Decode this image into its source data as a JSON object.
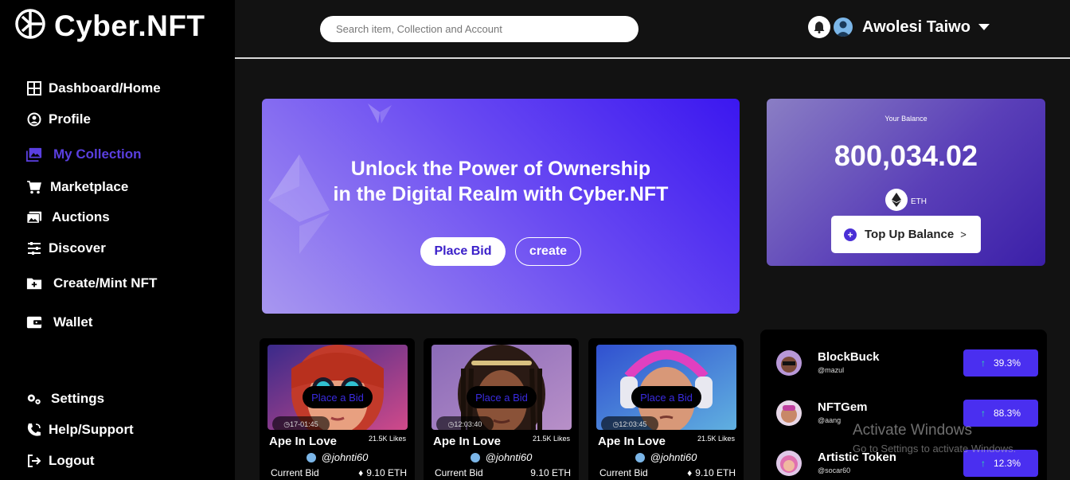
{
  "brand": {
    "name": "Cyber.NFT"
  },
  "sidebar": {
    "items": [
      {
        "label": "Dashboard/Home",
        "icon": "grid-icon"
      },
      {
        "label": "Profile",
        "icon": "user-circle-icon"
      },
      {
        "label": "My Collection",
        "icon": "images-icon"
      },
      {
        "label": "Marketplace",
        "icon": "cart-icon"
      },
      {
        "label": "Auctions",
        "icon": "photos-icon"
      },
      {
        "label": "Discover",
        "icon": "sliders-icon"
      },
      {
        "label": "Create/Mint NFT",
        "icon": "folder-plus-icon"
      },
      {
        "label": "Wallet",
        "icon": "wallet-icon"
      }
    ],
    "bottom": [
      {
        "label": "Settings",
        "icon": "gears-icon"
      },
      {
        "label": "Help/Support",
        "icon": "phone-icon"
      },
      {
        "label": "Logout",
        "icon": "logout-icon"
      }
    ],
    "active_color": "#5a3fe0"
  },
  "header": {
    "search_placeholder": "Search item, Collection and Account",
    "user_name": "Awolesi Taiwo"
  },
  "hero": {
    "title_line1": "Unlock the Power of Ownership",
    "title_line2": "in the Digital Realm with Cyber.NFT",
    "bid_label": "Place Bid",
    "create_label": "create"
  },
  "balance": {
    "label": "Your Balance",
    "value": "800,034.02",
    "currency": "ETH",
    "topup_label": "Top Up Balance",
    "topup_chevron": ">"
  },
  "cards": [
    {
      "title": "Ape In Love",
      "likes": "21.5K Likes",
      "user": "@johnti60",
      "timer": "17-01:45",
      "bid_label": "Current Bid",
      "bid_value": "9.10 ETH",
      "overlay": "Place a Bid"
    },
    {
      "title": "Ape In Love",
      "likes": "21.5K Likes",
      "user": "@johnti60",
      "timer": "12:03:40",
      "bid_label": "Current Bid",
      "bid_value": "9.10 ETH",
      "overlay": "Place a Bid"
    },
    {
      "title": "Ape In Love",
      "likes": "21.5K Likes",
      "user": "@johnti60",
      "timer": "12:03:45",
      "bid_label": "Current Bid",
      "bid_value": "9.10 ETH",
      "overlay": "Place a Bid"
    }
  ],
  "trending": [
    {
      "name": "BlockBuck",
      "user": "@mazul",
      "change": "39.3%"
    },
    {
      "name": "NFTGem",
      "user": "@aang",
      "change": "88.3%"
    },
    {
      "name": "Artistic Token",
      "user": "@socar60",
      "change": "12.3%"
    }
  ],
  "watermark": {
    "line1": "Activate Windows",
    "line2": "Go to Settings to activate Windows."
  }
}
